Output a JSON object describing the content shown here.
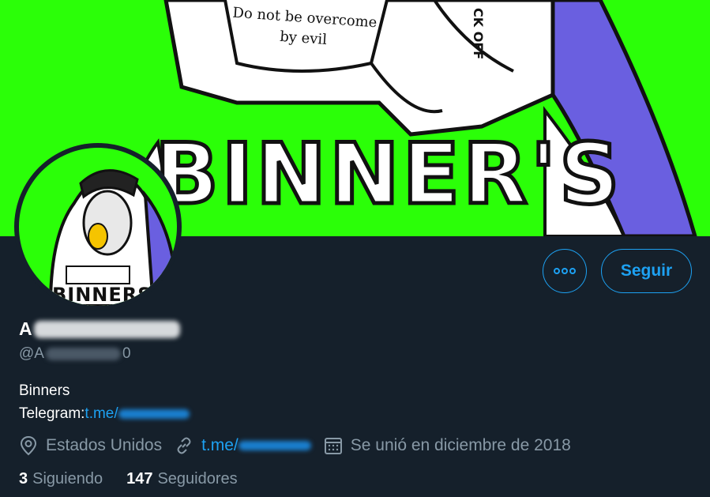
{
  "banner": {
    "headline": "BINNER'S",
    "note": "Do not be overcome by evil",
    "side_text": "CK OFF"
  },
  "avatar": {
    "label": "BINNERS"
  },
  "actions": {
    "more_icon": "more-horizontal-icon",
    "follow_label": "Seguir"
  },
  "profile": {
    "name_visible": "A",
    "handle_prefix": "@A",
    "handle_suffix": "0",
    "bio_line1": "Binners",
    "bio_line2_label": "Telegram: ",
    "bio_line2_link": "t.me/"
  },
  "meta": {
    "location_icon": "location-pin-icon",
    "location": "Estados Unidos",
    "link_icon": "link-icon",
    "link": "t.me/",
    "calendar_icon": "calendar-icon",
    "joined": "Se unió en diciembre de 2018"
  },
  "stats": {
    "following_count": "3",
    "following_label": "Siguiendo",
    "followers_count": "147",
    "followers_label": "Seguidores"
  },
  "colors": {
    "accent": "#1da1f2",
    "background": "#15202b",
    "muted": "#8899a6",
    "banner": "#2bff08"
  }
}
